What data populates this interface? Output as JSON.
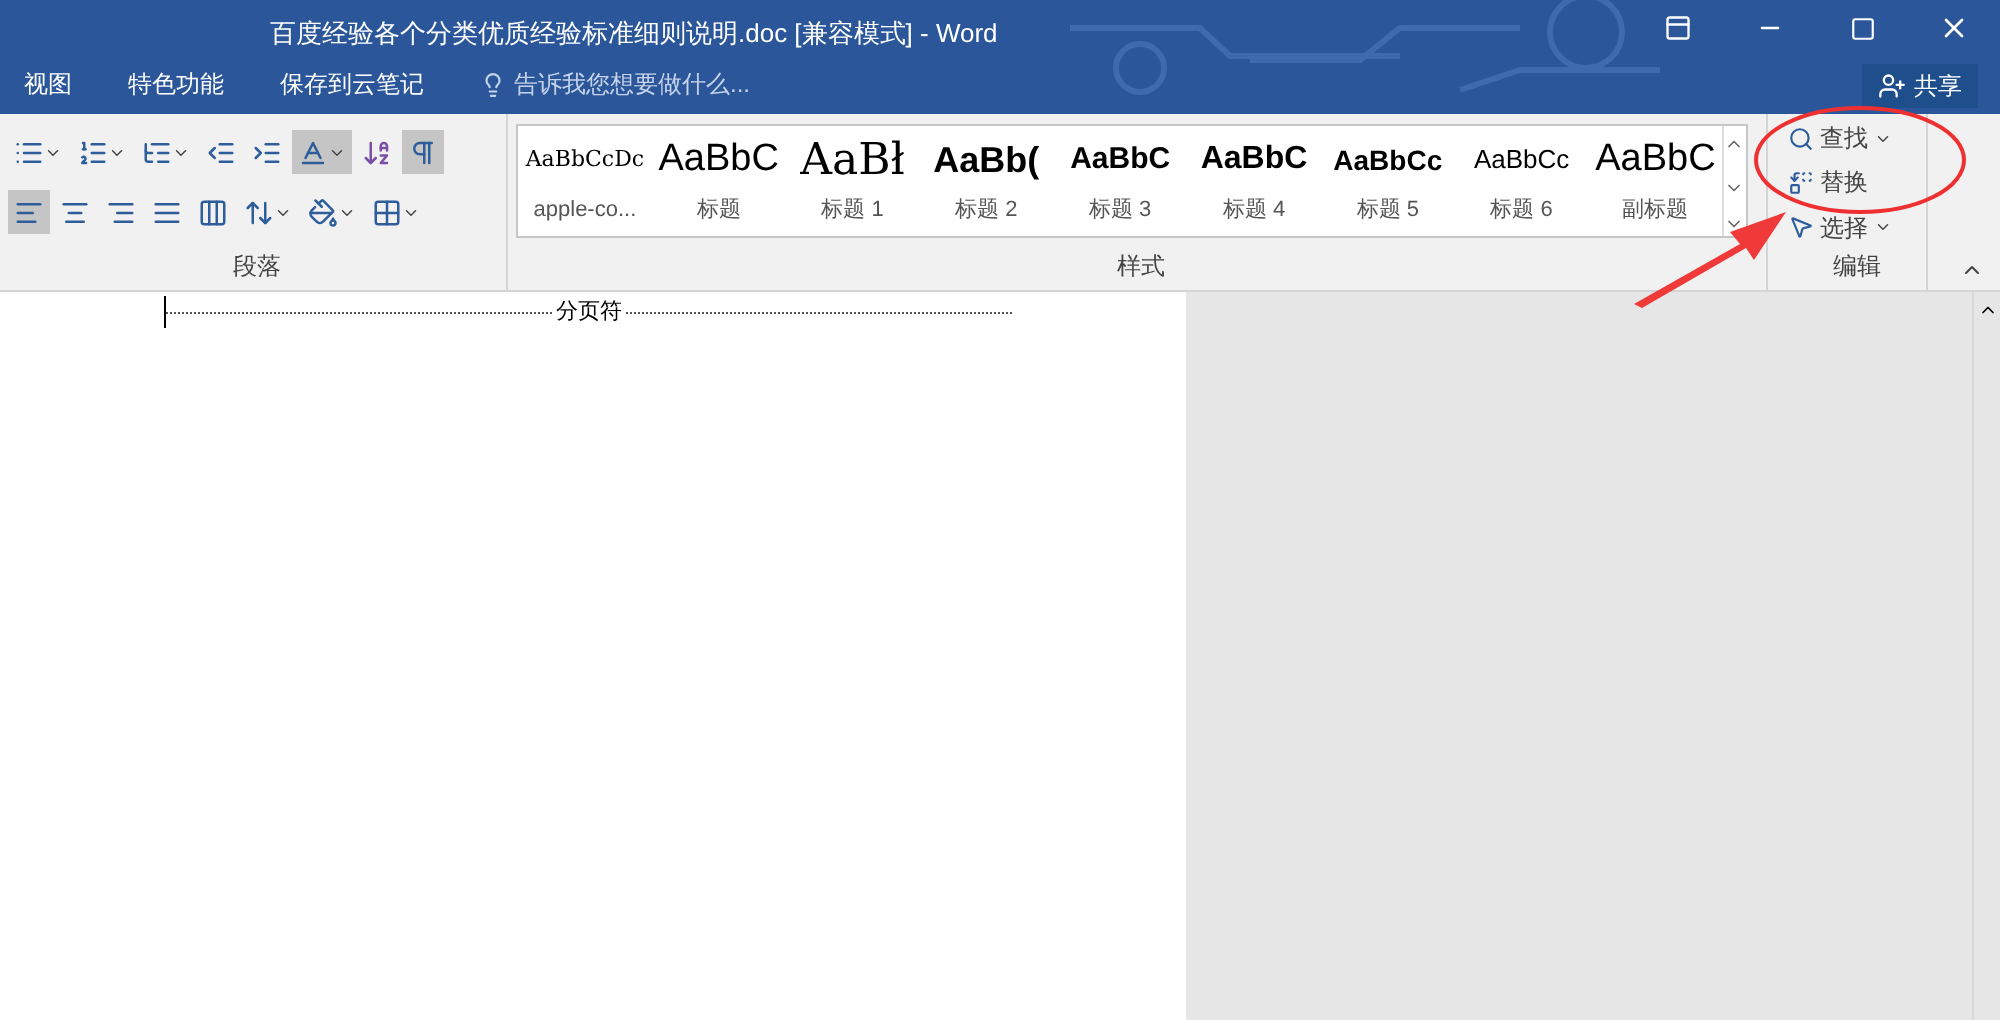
{
  "window": {
    "title": "百度经验各个分类优质经验标准细则说明.doc [兼容模式] - Word"
  },
  "menu_tabs": [
    "视图",
    "特色功能",
    "保存到云笔记"
  ],
  "tell_me": {
    "placeholder": "告诉我您想要做什么..."
  },
  "share_button": {
    "label": "共享"
  },
  "paragraph_group": {
    "label": "段落",
    "rows": [
      [
        {
          "kind": "bullets",
          "dropdown": true,
          "selected": false
        },
        {
          "kind": "numbering",
          "dropdown": true,
          "selected": false
        },
        {
          "kind": "multilevel",
          "dropdown": true,
          "selected": false
        },
        {
          "kind": "outdent",
          "dropdown": false,
          "selected": false
        },
        {
          "kind": "indent",
          "dropdown": false,
          "selected": false
        },
        {
          "kind": "asian-layout",
          "dropdown": true,
          "selected": true
        },
        {
          "kind": "sort",
          "dropdown": false,
          "selected": false
        },
        {
          "kind": "marks",
          "dropdown": false,
          "selected": true
        }
      ],
      [
        {
          "kind": "align-left",
          "dropdown": false,
          "selected": true
        },
        {
          "kind": "align-center",
          "dropdown": false,
          "selected": false
        },
        {
          "kind": "align-right",
          "dropdown": false,
          "selected": false
        },
        {
          "kind": "justify",
          "dropdown": false,
          "selected": false
        },
        {
          "kind": "distributed",
          "dropdown": false,
          "selected": false
        },
        {
          "kind": "line-spacing",
          "dropdown": true,
          "selected": false
        },
        {
          "kind": "shading",
          "dropdown": true,
          "selected": false
        },
        {
          "kind": "borders",
          "dropdown": true,
          "selected": false
        }
      ]
    ]
  },
  "styles_group": {
    "label": "样式",
    "styles": [
      {
        "preview": "AaBbCcDc",
        "name": "apple-co..."
      },
      {
        "preview": "AaBbC",
        "name": "标题"
      },
      {
        "preview": "AaBł",
        "name": "标题 1"
      },
      {
        "preview": "AaBb(",
        "name": "标题 2"
      },
      {
        "preview": "AaBbC",
        "name": "标题 3"
      },
      {
        "preview": "AaBbC",
        "name": "标题 4"
      },
      {
        "preview": "AaBbCc",
        "name": "标题 5"
      },
      {
        "preview": "AaBbCc",
        "name": "标题 6"
      },
      {
        "preview": "AaBbC",
        "name": "副标题"
      }
    ]
  },
  "editing_group": {
    "label": "编辑",
    "items": [
      {
        "kind": "find",
        "label": "查找",
        "dropdown": true
      },
      {
        "kind": "replace",
        "label": "替换",
        "dropdown": false
      },
      {
        "kind": "select",
        "label": "选择",
        "dropdown": true
      }
    ]
  },
  "document": {
    "page_break": "分页符"
  }
}
